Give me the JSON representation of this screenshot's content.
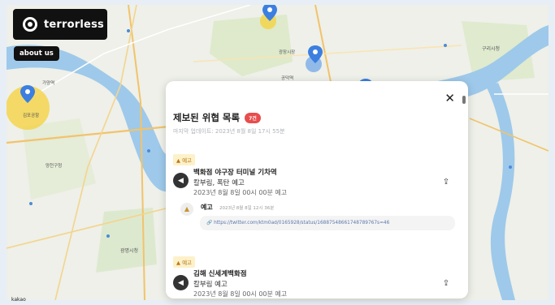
{
  "brand": {
    "name": "terrorless",
    "logo_icon": "target-ring-icon"
  },
  "nav": {
    "about_label": "about us"
  },
  "map": {
    "labels": [
      {
        "id": "label-north-station",
        "text": "가양역"
      },
      {
        "id": "label-center",
        "text": "공덕역"
      },
      {
        "id": "label-gimpo",
        "text": "김포공항"
      },
      {
        "id": "label-east",
        "text": "구리시청"
      },
      {
        "id": "label-dongdaemun",
        "text": "광장시장"
      },
      {
        "id": "label-south",
        "text": "광명시청"
      },
      {
        "id": "label-river-south",
        "text": "양천구청"
      }
    ],
    "scale_label": "kakao",
    "pin_color": "#3c7fe0",
    "highlight_color": "#f5d23a"
  },
  "panel": {
    "title": "제보된 위협 목록",
    "count_badge": "7건",
    "updated": "마지막 업데이트: 2023년 8월 8일 17시 55분",
    "close_icon": "close-icon",
    "items": [
      {
        "badge": "▲ 예고",
        "title": "백화점 야구장 터미널 기차역",
        "subtitle": "칼부림, 폭탄 예고",
        "time": "2023년 8월 8일 00시 00분 예고",
        "notice_label": "예고",
        "notice_time": "2023년 8월 8일 12시 36분",
        "notice_link": "https://twitter.com/ktm0ad/0165928/status/16887548661748789767s=46"
      },
      {
        "badge": "▲ 예고",
        "title": "김해 신세계백화점",
        "subtitle": "칼부림 예고",
        "time": "2023년 8월 8일 00시 00분 예고"
      }
    ]
  }
}
